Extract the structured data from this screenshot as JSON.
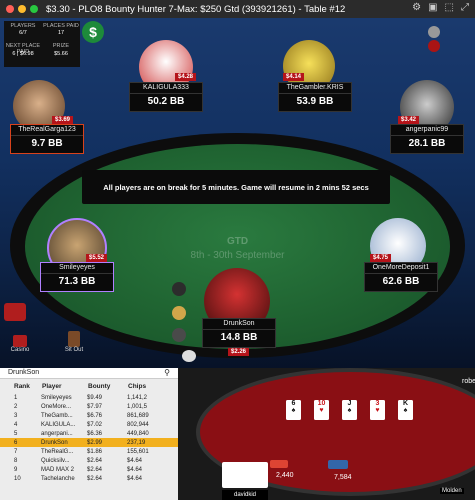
{
  "window": {
    "title": "$3.30 - PLO8 Bounty Hunter 7-Max: $250 Gtd  (393921261) - Table #12"
  },
  "info": {
    "players_label": "PLAYERS",
    "players_value": "6/7",
    "places_label": "PLACES PAID",
    "places_value": "17",
    "next_label": "NEXT PLACE PAID",
    "next_value": "6 | $6.98",
    "prize_label": "PRIZE",
    "prize_value": "$5.66",
    "dollar_icon": "$"
  },
  "table": {
    "break_message": "All players are on break for 5 minutes. Game will resume in 2 mins 52 secs",
    "felt_line1": "GTD",
    "felt_line2": "8th - 30th September"
  },
  "seats": [
    {
      "name": "KALIGULA333",
      "chips": "50.2 BB",
      "bounty": "$4.28"
    },
    {
      "name": "TheGambler.KRIS",
      "chips": "53.9 BB",
      "bounty": "$4.14"
    },
    {
      "name": "TheRealGarga123",
      "chips": "9.7 BB",
      "bounty": "$3.69"
    },
    {
      "name": "angerpanic99",
      "chips": "28.1 BB",
      "bounty": "$3.42"
    },
    {
      "name": "Smileyeyes",
      "chips": "71.3 BB",
      "bounty": "$5.52"
    },
    {
      "name": "OneMoreDeposit1",
      "chips": "62.6 BB",
      "bounty": "$4.75"
    },
    {
      "name": "DrunkSon",
      "chips": "14.8 BB",
      "bounty": "$2.26"
    }
  ],
  "side": {
    "casino_label": "Casino",
    "sitout_label": "Sit Out"
  },
  "lobby": {
    "search_value": "DrunkSon",
    "columns": [
      "Rank",
      "Player",
      "Bounty",
      "Chips"
    ],
    "rows": [
      [
        "1",
        "Smileyeyes",
        "$9.49",
        "1,141,2"
      ],
      [
        "2",
        "OneMore...",
        "$7.97",
        "1,001,5"
      ],
      [
        "3",
        "TheGamb...",
        "$6.76",
        "861,689"
      ],
      [
        "4",
        "KALIGULA...",
        "$7.02",
        "802,944"
      ],
      [
        "5",
        "angerpani...",
        "$6.36",
        "449,840"
      ],
      [
        "6",
        "DrunkSon",
        "$2.99",
        "237,19"
      ],
      [
        "7",
        "TheRealG...",
        "$1.86",
        "155,601"
      ],
      [
        "8",
        "Quicksilv...",
        "$2.64",
        "$4.64"
      ],
      [
        "9",
        "MAD MAX 2",
        "$2.64",
        "$4.64"
      ],
      [
        "10",
        "Tachelanche",
        "$2.64",
        "$4.64"
      ]
    ]
  },
  "mini": {
    "board": [
      {
        "rank": "6",
        "suit": "♠",
        "red": false
      },
      {
        "rank": "10",
        "suit": "♥",
        "red": true
      },
      {
        "rank": "J",
        "suit": "♠",
        "red": false
      },
      {
        "rank": "3",
        "suit": "♥",
        "red": true
      },
      {
        "rank": "K",
        "suit": "♠",
        "red": false
      }
    ],
    "pot_left": "2,440",
    "pot_right": "7,584",
    "player_name": "davidkid",
    "right_name": "robe",
    "right_bottom": "Molden"
  }
}
